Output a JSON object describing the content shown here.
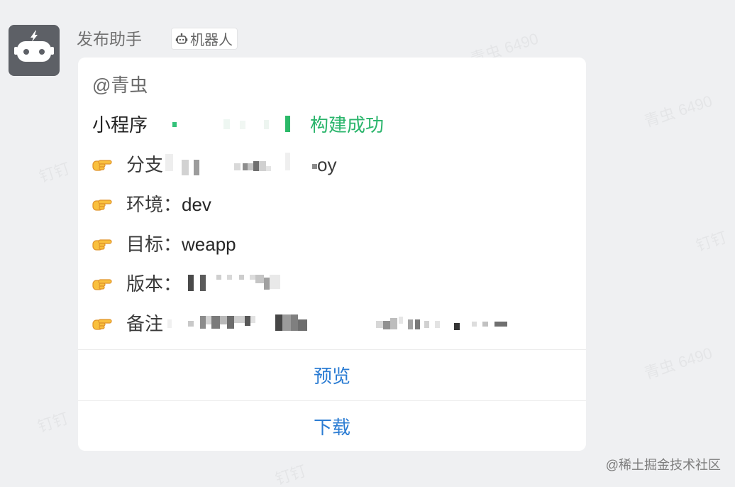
{
  "message": {
    "sender": "发布助手",
    "badge": "机器人",
    "card": {
      "mention": "@青虫",
      "app_type": "小程序",
      "status": "构建成功",
      "fields": [
        {
          "label": "分支",
          "value": "oy",
          "redacted": true
        },
        {
          "label": "环境：",
          "value": "dev"
        },
        {
          "label": "目标：",
          "value": "weapp"
        },
        {
          "label": "版本：",
          "redacted": true
        },
        {
          "label": "备注",
          "redacted": true
        }
      ],
      "actions": [
        {
          "label": "预览"
        },
        {
          "label": "下载"
        }
      ]
    }
  },
  "footer": {
    "source": "@稀土掘金技术社区"
  },
  "watermark": {
    "user": "青虫 6490",
    "app": "钉钉"
  },
  "icons": {
    "avatar": "robot-icon",
    "badge": "robot-outline-icon",
    "bullet": "pointing-hand-icon"
  },
  "colors": {
    "success_green": "#2bb56c",
    "action_blue": "#2b7cd3",
    "avatar_bg": "#5d6066"
  }
}
